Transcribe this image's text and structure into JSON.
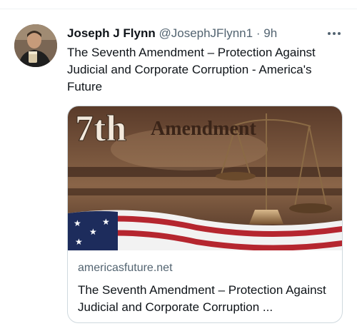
{
  "tweet": {
    "author_name": "Joseph J Flynn",
    "handle": "@JosephJFlynn1",
    "separator": "·",
    "time": "9h",
    "text": "The Seventh Amendment – Protection Against Judicial and Corporate Corruption - America's Future"
  },
  "card": {
    "image_text_ordinal": "7th",
    "image_text_word": "Amendment",
    "domain": "americasfuture.net",
    "title": "The Seventh Amendment – Protection Against Judicial and Corporate Corruption ..."
  },
  "icons": {
    "more": "more-horizontal-icon"
  },
  "colors": {
    "text_primary": "#0f1419",
    "text_secondary": "#536471",
    "card_border": "#cfd9de"
  }
}
